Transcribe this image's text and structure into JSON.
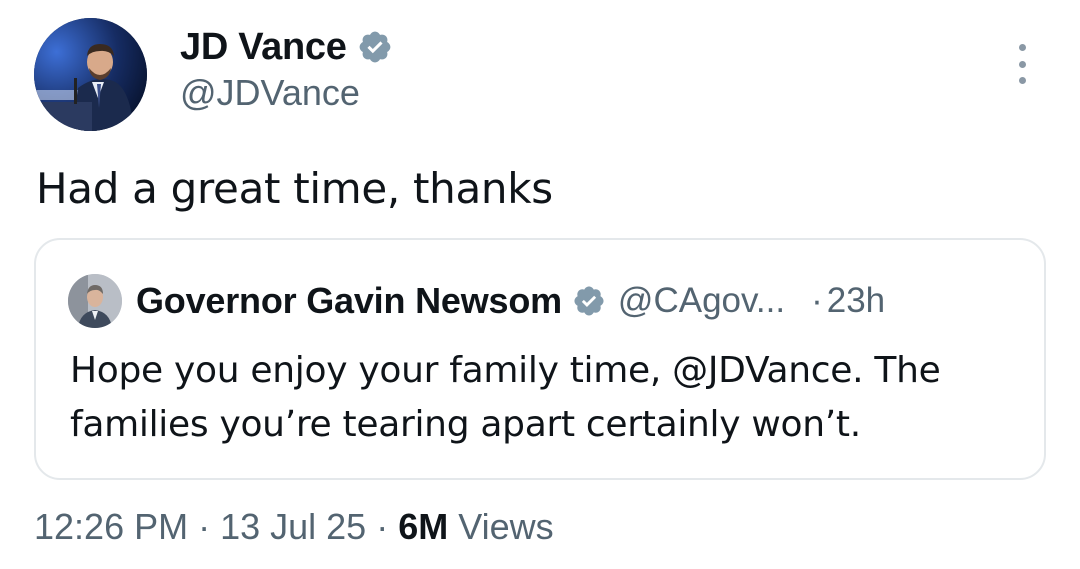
{
  "tweet": {
    "author": {
      "display_name": "JD Vance",
      "handle": "@JDVance",
      "verified": true,
      "avatar_icon": "person-at-podium-photo"
    },
    "text": "Had a great time, thanks",
    "more_icon": "more-options-icon",
    "quoted": {
      "display_name": "Governor Gavin Newsom",
      "handle": "@CAgov...",
      "separator": "·",
      "time": "23h",
      "verified": true,
      "avatar_icon": "person-portrait-photo",
      "text": "Hope you enjoy your family time, @JDVance. The families you’re tearing apart certainly won’t."
    },
    "meta": {
      "time": "12:26 PM",
      "sep1": " · ",
      "date": "13 Jul 25",
      "sep2": " · ",
      "views_count": "6M",
      "views_label": " Views"
    }
  },
  "colors": {
    "text_primary": "#0f1419",
    "text_secondary": "#536471",
    "verified_badge": "#829aab",
    "border": "#e4e8eb"
  }
}
